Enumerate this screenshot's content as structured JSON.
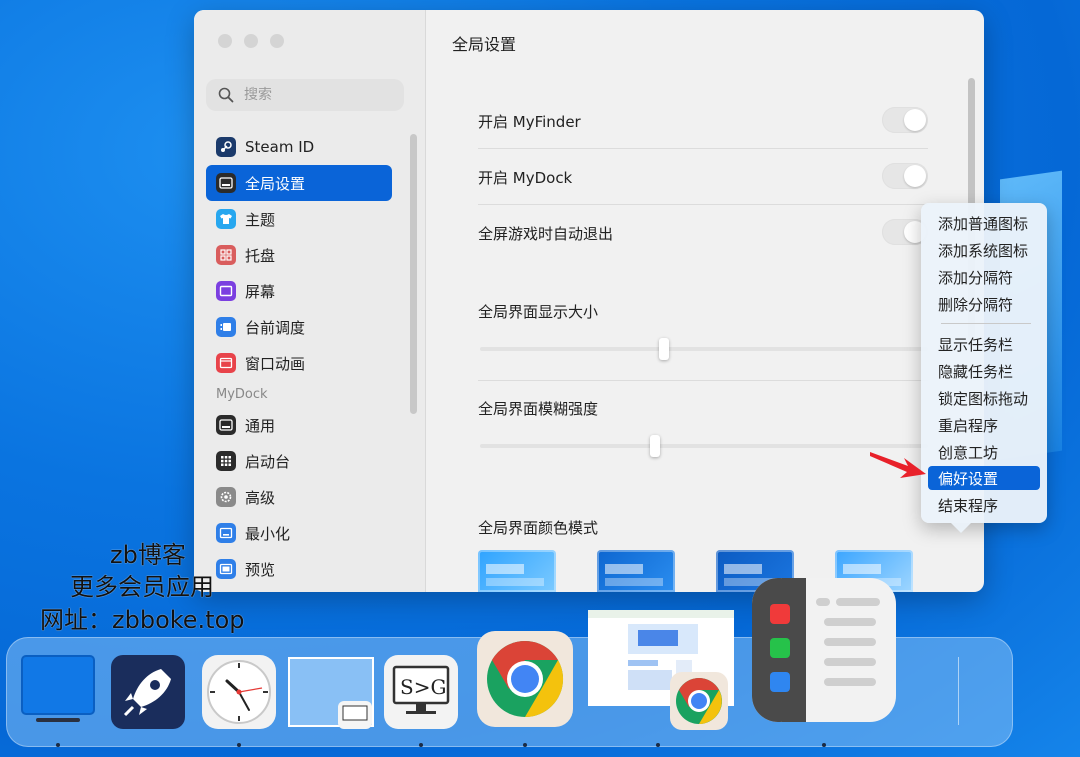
{
  "window": {
    "search": {
      "placeholder": "搜索"
    },
    "sidebar": {
      "items": [
        {
          "label": "Steam ID",
          "icon": "steam-icon",
          "color": "#1b3a6b"
        },
        {
          "label": "全局设置",
          "icon": "dock-icon",
          "color": "#2b2b2b",
          "active": true
        },
        {
          "label": "主题",
          "icon": "shirt-icon",
          "color": "#27a7ef"
        },
        {
          "label": "托盘",
          "icon": "grid-icon",
          "color": "#d95d5d"
        },
        {
          "label": "屏幕",
          "icon": "screen-icon",
          "color": "#7b3fe0"
        },
        {
          "label": "台前调度",
          "icon": "stage-icon",
          "color": "#2f7fe8"
        },
        {
          "label": "窗口动画",
          "icon": "window-icon",
          "color": "#e8434a"
        }
      ],
      "group2": "MyDock",
      "items2": [
        {
          "label": "通用",
          "icon": "dock-icon",
          "color": "#2b2b2b"
        },
        {
          "label": "启动台",
          "icon": "grid-icon",
          "color": "#2b2b2b"
        },
        {
          "label": "高级",
          "icon": "gear-icon",
          "color": "#8a8a8a"
        },
        {
          "label": "最小化",
          "icon": "minimize-icon",
          "color": "#2f7fe8"
        },
        {
          "label": "预览",
          "icon": "preview-icon",
          "color": "#2f7fe8"
        }
      ]
    },
    "main": {
      "title": "全局设置",
      "toggle1": "开启 MyFinder",
      "toggle2": "开启 MyDock",
      "toggle3": "全屏游戏时自动退出",
      "slider1": {
        "label": "全局界面显示大小",
        "value": 0.4
      },
      "slider2": {
        "label": "全局界面模糊强度",
        "value": 0.38
      },
      "color_mode": "全局界面颜色模式"
    }
  },
  "context_menu": {
    "items": [
      "添加普通图标",
      "添加系统图标",
      "添加分隔符",
      "删除分隔符"
    ],
    "items2": [
      "显示任务栏",
      "隐藏任务栏",
      "锁定图标拖动",
      "重启程序",
      "创意工坊",
      "偏好设置",
      "结束程序"
    ],
    "highlighted": "偏好设置"
  },
  "watermark": {
    "line1": "zb博客",
    "line2": "更多会员应用",
    "line3": "网址：zbboke.top"
  },
  "dock": {
    "apps": [
      "finder-icon",
      "rocket-icon",
      "clock-icon",
      "window-preview",
      "s-g-icon",
      "chrome-icon",
      "browser-preview",
      "notes-icon"
    ],
    "s_g_text": "S>G"
  }
}
